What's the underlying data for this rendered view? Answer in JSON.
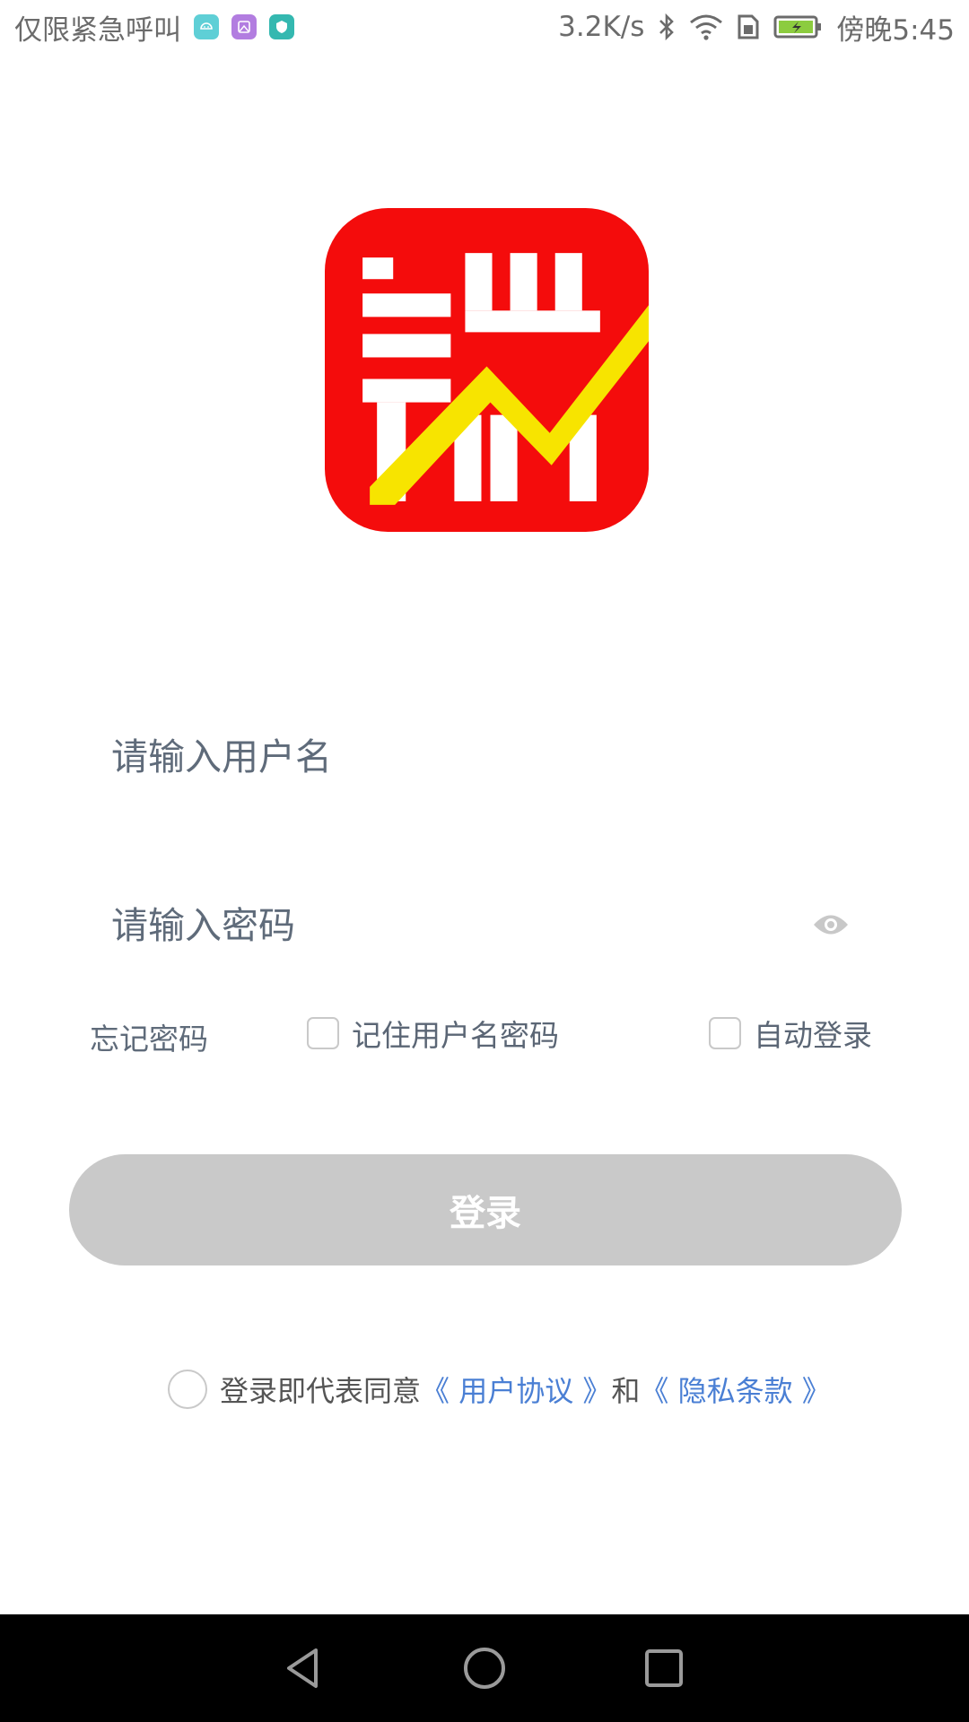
{
  "status_bar": {
    "left_text": "仅限紧急呼叫",
    "speed": "3.2K/s",
    "time": "傍晚5:45",
    "icons": [
      "android-app-icon",
      "gallery-app-icon",
      "shield-app-icon",
      "bluetooth-icon",
      "wifi-icon",
      "sim-icon",
      "battery-icon"
    ],
    "chip_colors": [
      "#5fcfd6",
      "#b27de0",
      "#34b8b0"
    ]
  },
  "logo": {
    "name": "app-logo",
    "colors": {
      "background": "#f40c0c",
      "accent": "#f7e400",
      "glyph": "#ffffff"
    }
  },
  "form": {
    "username_placeholder": "请输入用户名",
    "password_placeholder": "请输入密码",
    "forgot_password": "忘记密码",
    "remember_label": "记住用户名密码",
    "auto_login_label": "自动登录",
    "login_button": "登录"
  },
  "agreement": {
    "prefix": "登录即代表同意",
    "user_agreement": "《 用户协议 》",
    "conjunction": "和",
    "privacy_terms": "《 隐私条款 》",
    "link_color": "#4a7fd4"
  },
  "nav": {
    "buttons": [
      "back-icon",
      "home-icon",
      "recent-apps-icon"
    ]
  }
}
